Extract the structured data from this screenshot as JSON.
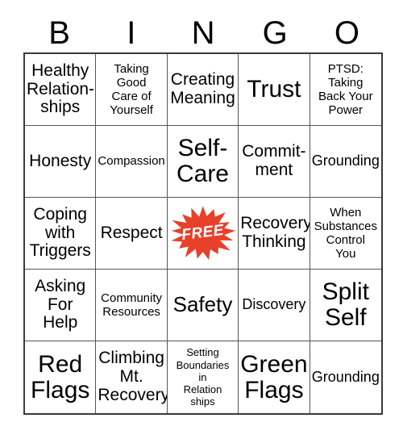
{
  "header": {
    "letters": [
      "B",
      "I",
      "N",
      "G",
      "O"
    ]
  },
  "free_space": {
    "label": "FREE",
    "star_color": "#E8402A",
    "text_color": "#FFFFFF",
    "icon": "starburst-icon"
  },
  "grid": {
    "columns": 5,
    "rows": 5,
    "border_color": "#3A3A3A",
    "cells": [
      {
        "text": "Healthy\nRelation-\nships",
        "size": "lg"
      },
      {
        "text": "Taking\nGood\nCare of\nYourself",
        "size": "sm"
      },
      {
        "text": "Creating\nMeaning",
        "size": "lg"
      },
      {
        "text": "Trust",
        "size": "xxl"
      },
      {
        "text": "PTSD:\nTaking\nBack Your\nPower",
        "size": "sm"
      },
      {
        "text": "Honesty",
        "size": "lg"
      },
      {
        "text": "Compassion",
        "size": "sm"
      },
      {
        "text": "Self-\nCare",
        "size": "xxl"
      },
      {
        "text": "Commit-\nment",
        "size": "lg"
      },
      {
        "text": "Grounding",
        "size": "md"
      },
      {
        "text": "Coping\nwith\nTriggers",
        "size": "lg"
      },
      {
        "text": "Respect",
        "size": "lg"
      },
      {
        "text": "FREE",
        "size": "free"
      },
      {
        "text": "Recovery\nThinking",
        "size": "lg"
      },
      {
        "text": "When\nSubstances\nControl\nYou",
        "size": "sm"
      },
      {
        "text": "Asking\nFor\nHelp",
        "size": "lg"
      },
      {
        "text": "Community\nResources",
        "size": "sm"
      },
      {
        "text": "Safety",
        "size": "xl"
      },
      {
        "text": "Discovery",
        "size": "md"
      },
      {
        "text": "Split\nSelf",
        "size": "xxl"
      },
      {
        "text": "Red\nFlags",
        "size": "xxl"
      },
      {
        "text": "Climbing\nMt.\nRecovery",
        "size": "lg"
      },
      {
        "text": "Setting\nBoundaries\nin\nRelation\nships",
        "size": "xs"
      },
      {
        "text": "Green\nFlags",
        "size": "xxl"
      },
      {
        "text": "Grounding",
        "size": "md"
      }
    ]
  }
}
